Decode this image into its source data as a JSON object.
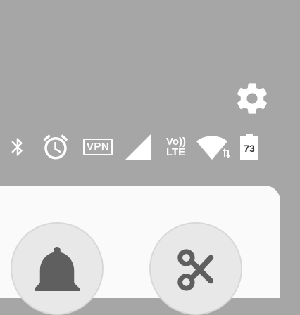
{
  "status_bar": {
    "icons": [
      "bluetooth-icon",
      "alarm-icon",
      "vpn-icon",
      "cell-signal-icon",
      "volte-icon",
      "wifi-icon",
      "battery-icon"
    ],
    "vpn_label": "VPN",
    "volte_top": "Vo))",
    "volte_bottom": "LTE",
    "battery_level": "73"
  },
  "quick_settings": {
    "tiles": [
      {
        "icon": "bell-icon"
      },
      {
        "icon": "scissors-icon"
      }
    ]
  },
  "colors": {
    "scrim": "#a6a6a6",
    "panel": "#fafafa",
    "tile": "#e8e8e8",
    "icon_dark": "#5f5f5f",
    "status_icon": "#ffffff"
  }
}
